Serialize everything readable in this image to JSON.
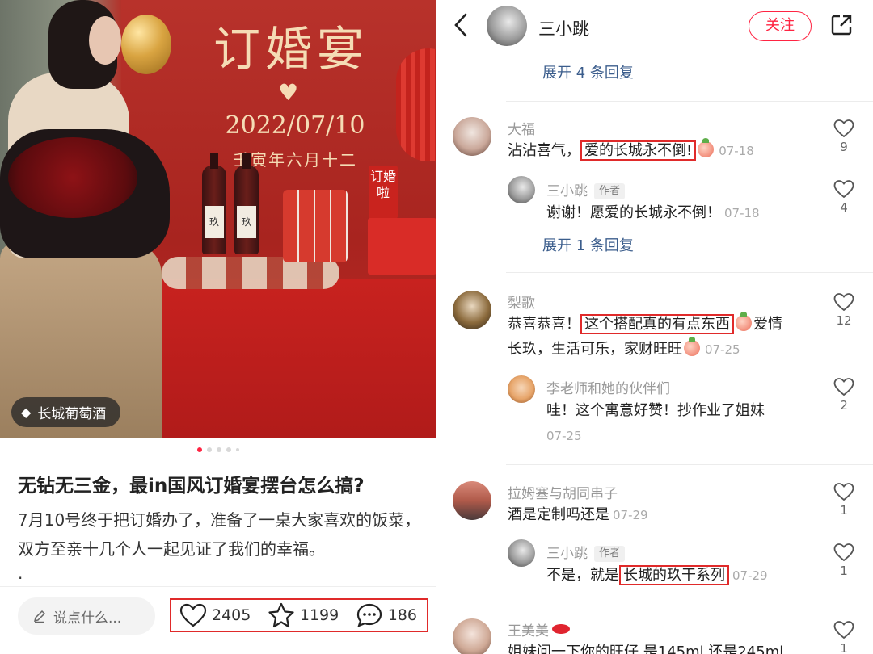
{
  "post": {
    "image_overlay": {
      "title": "订婚宴",
      "date": "2022/07/10",
      "lunar": "壬寅年六月十二",
      "sign": "订婚啦",
      "bottle_label": "玖"
    },
    "tag_label": "长城葡萄酒",
    "carousel": {
      "total": 5,
      "active": 1
    },
    "title": "无钻无三金，最in国风订婚宴摆台怎么搞?",
    "body": "7月10号终于把订婚办了，准备了一桌大家喜欢的饭菜，双方至亲十几个人一起见证了我们的幸福。",
    "body_trailing": ".",
    "comment_placeholder": "说点什么...",
    "likes": "2405",
    "collects": "1199",
    "comments": "186"
  },
  "header": {
    "author_name": "三小跳",
    "follow_label": "关注"
  },
  "comments_panel": {
    "top_expand": "展开 4 条回复",
    "author_badge": "作者",
    "threads": [
      {
        "user": "大福",
        "text_before": "沾沾喜气，",
        "highlight": "爱的长城永不倒!",
        "text_after": "",
        "time": "07-18",
        "likes": "9",
        "reply": {
          "user": "三小跳",
          "text": "谢谢！愿爱的长城永不倒！",
          "time": "07-18",
          "likes": "4"
        },
        "expand": "展开 1 条回复"
      },
      {
        "user": "梨歌",
        "text_before": "恭喜恭喜！",
        "highlight": "这个搭配真的有点东西",
        "text_after": "爱情",
        "line2": "长玖，生活可乐，家财旺旺",
        "time": "07-25",
        "likes": "12",
        "reply": {
          "user": "李老师和她的伙伴们",
          "text": "哇！这个寓意好赞！抄作业了姐妹",
          "time": "07-25",
          "likes": "2"
        }
      },
      {
        "user": "拉姆塞与胡同串子",
        "text": "酒是定制吗还是",
        "time": "07-29",
        "likes": "1",
        "reply": {
          "user": "三小跳",
          "text_before": "不是，就是",
          "highlight": "长城的玖干系列",
          "time": "07-29",
          "likes": "1"
        }
      },
      {
        "user": "王美美",
        "text": "姐妹问一下你的旺仔 是145ml 还是245ml",
        "likes": "1"
      }
    ]
  },
  "colors": {
    "accent_red": "#ff2442",
    "highlight_box": "#e02a2a",
    "link_blue": "#3b5d8c"
  }
}
